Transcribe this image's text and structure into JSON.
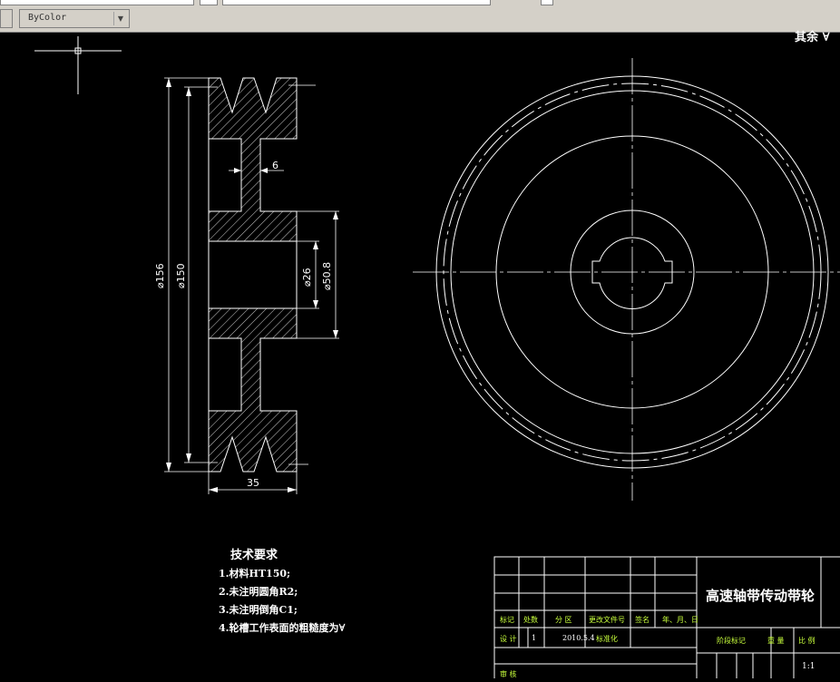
{
  "toolbar": {
    "color_dropdown": "ByColor",
    "dropdown_arrow": "▼"
  },
  "drawing": {
    "corner_text": "其余",
    "dims": {
      "d156": "⌀156",
      "d150": "⌀150",
      "d26": "⌀26",
      "d50_8": "⌀50.8",
      "w6": "6",
      "w35": "35"
    }
  },
  "tech_requirements": {
    "title": "技术要求",
    "items": [
      "1.材料HT150;",
      "2.未注明圆角R2;",
      "3.未注明倒角C1;",
      "4.轮槽工作表面的粗糙度为"
    ]
  },
  "title_block": {
    "part_name": "高速轴带传动带轮",
    "headers": [
      "标记",
      "处数",
      "分 区",
      "更改文件号",
      "签名",
      "年、月、日"
    ],
    "design_label": "设 计",
    "design_count": "1",
    "design_date": "2010.5.4",
    "standardize_label": "标准化",
    "stage_label": "阶段标记",
    "weight_label": "重 量",
    "scale_label": "比 例",
    "scale_value": "1:1",
    "review_label": "审 核"
  }
}
